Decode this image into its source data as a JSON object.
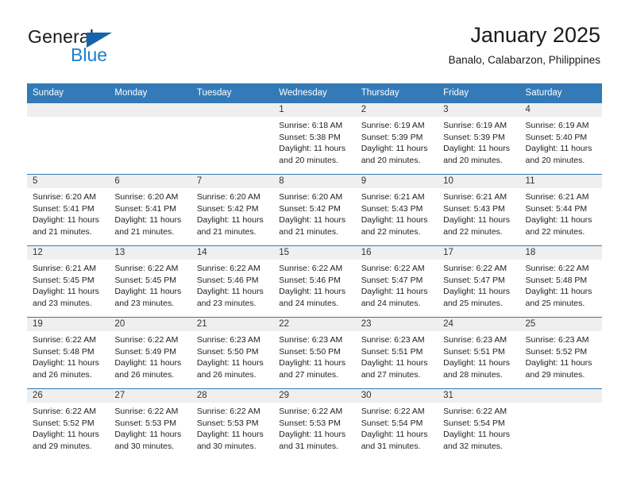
{
  "brand": {
    "name_part1": "General",
    "name_part2": "Blue",
    "triangle_color": "#1464ac",
    "blue_color": "#1a7ed0"
  },
  "header": {
    "title": "January 2025",
    "subtitle": "Banalo, Calabarzon, Philippines"
  },
  "theme": {
    "header_row_bg": "#337ab7",
    "daynum_bg": "#efefef",
    "grid_line": "#337ab7"
  },
  "calendar": {
    "weekday_headers": [
      "Sunday",
      "Monday",
      "Tuesday",
      "Wednesday",
      "Thursday",
      "Friday",
      "Saturday"
    ],
    "weeks": [
      [
        {
          "day": "",
          "empty": true
        },
        {
          "day": "",
          "empty": true
        },
        {
          "day": "",
          "empty": true
        },
        {
          "day": "1",
          "sunrise": "Sunrise: 6:18 AM",
          "sunset": "Sunset: 5:38 PM",
          "daylight": "Daylight: 11 hours and 20 minutes."
        },
        {
          "day": "2",
          "sunrise": "Sunrise: 6:19 AM",
          "sunset": "Sunset: 5:39 PM",
          "daylight": "Daylight: 11 hours and 20 minutes."
        },
        {
          "day": "3",
          "sunrise": "Sunrise: 6:19 AM",
          "sunset": "Sunset: 5:39 PM",
          "daylight": "Daylight: 11 hours and 20 minutes."
        },
        {
          "day": "4",
          "sunrise": "Sunrise: 6:19 AM",
          "sunset": "Sunset: 5:40 PM",
          "daylight": "Daylight: 11 hours and 20 minutes."
        }
      ],
      [
        {
          "day": "5",
          "sunrise": "Sunrise: 6:20 AM",
          "sunset": "Sunset: 5:41 PM",
          "daylight": "Daylight: 11 hours and 21 minutes."
        },
        {
          "day": "6",
          "sunrise": "Sunrise: 6:20 AM",
          "sunset": "Sunset: 5:41 PM",
          "daylight": "Daylight: 11 hours and 21 minutes."
        },
        {
          "day": "7",
          "sunrise": "Sunrise: 6:20 AM",
          "sunset": "Sunset: 5:42 PM",
          "daylight": "Daylight: 11 hours and 21 minutes."
        },
        {
          "day": "8",
          "sunrise": "Sunrise: 6:20 AM",
          "sunset": "Sunset: 5:42 PM",
          "daylight": "Daylight: 11 hours and 21 minutes."
        },
        {
          "day": "9",
          "sunrise": "Sunrise: 6:21 AM",
          "sunset": "Sunset: 5:43 PM",
          "daylight": "Daylight: 11 hours and 22 minutes."
        },
        {
          "day": "10",
          "sunrise": "Sunrise: 6:21 AM",
          "sunset": "Sunset: 5:43 PM",
          "daylight": "Daylight: 11 hours and 22 minutes."
        },
        {
          "day": "11",
          "sunrise": "Sunrise: 6:21 AM",
          "sunset": "Sunset: 5:44 PM",
          "daylight": "Daylight: 11 hours and 22 minutes."
        }
      ],
      [
        {
          "day": "12",
          "sunrise": "Sunrise: 6:21 AM",
          "sunset": "Sunset: 5:45 PM",
          "daylight": "Daylight: 11 hours and 23 minutes."
        },
        {
          "day": "13",
          "sunrise": "Sunrise: 6:22 AM",
          "sunset": "Sunset: 5:45 PM",
          "daylight": "Daylight: 11 hours and 23 minutes."
        },
        {
          "day": "14",
          "sunrise": "Sunrise: 6:22 AM",
          "sunset": "Sunset: 5:46 PM",
          "daylight": "Daylight: 11 hours and 23 minutes."
        },
        {
          "day": "15",
          "sunrise": "Sunrise: 6:22 AM",
          "sunset": "Sunset: 5:46 PM",
          "daylight": "Daylight: 11 hours and 24 minutes."
        },
        {
          "day": "16",
          "sunrise": "Sunrise: 6:22 AM",
          "sunset": "Sunset: 5:47 PM",
          "daylight": "Daylight: 11 hours and 24 minutes."
        },
        {
          "day": "17",
          "sunrise": "Sunrise: 6:22 AM",
          "sunset": "Sunset: 5:47 PM",
          "daylight": "Daylight: 11 hours and 25 minutes."
        },
        {
          "day": "18",
          "sunrise": "Sunrise: 6:22 AM",
          "sunset": "Sunset: 5:48 PM",
          "daylight": "Daylight: 11 hours and 25 minutes."
        }
      ],
      [
        {
          "day": "19",
          "sunrise": "Sunrise: 6:22 AM",
          "sunset": "Sunset: 5:48 PM",
          "daylight": "Daylight: 11 hours and 26 minutes."
        },
        {
          "day": "20",
          "sunrise": "Sunrise: 6:22 AM",
          "sunset": "Sunset: 5:49 PM",
          "daylight": "Daylight: 11 hours and 26 minutes."
        },
        {
          "day": "21",
          "sunrise": "Sunrise: 6:23 AM",
          "sunset": "Sunset: 5:50 PM",
          "daylight": "Daylight: 11 hours and 26 minutes."
        },
        {
          "day": "22",
          "sunrise": "Sunrise: 6:23 AM",
          "sunset": "Sunset: 5:50 PM",
          "daylight": "Daylight: 11 hours and 27 minutes."
        },
        {
          "day": "23",
          "sunrise": "Sunrise: 6:23 AM",
          "sunset": "Sunset: 5:51 PM",
          "daylight": "Daylight: 11 hours and 27 minutes."
        },
        {
          "day": "24",
          "sunrise": "Sunrise: 6:23 AM",
          "sunset": "Sunset: 5:51 PM",
          "daylight": "Daylight: 11 hours and 28 minutes."
        },
        {
          "day": "25",
          "sunrise": "Sunrise: 6:23 AM",
          "sunset": "Sunset: 5:52 PM",
          "daylight": "Daylight: 11 hours and 29 minutes."
        }
      ],
      [
        {
          "day": "26",
          "sunrise": "Sunrise: 6:22 AM",
          "sunset": "Sunset: 5:52 PM",
          "daylight": "Daylight: 11 hours and 29 minutes."
        },
        {
          "day": "27",
          "sunrise": "Sunrise: 6:22 AM",
          "sunset": "Sunset: 5:53 PM",
          "daylight": "Daylight: 11 hours and 30 minutes."
        },
        {
          "day": "28",
          "sunrise": "Sunrise: 6:22 AM",
          "sunset": "Sunset: 5:53 PM",
          "daylight": "Daylight: 11 hours and 30 minutes."
        },
        {
          "day": "29",
          "sunrise": "Sunrise: 6:22 AM",
          "sunset": "Sunset: 5:53 PM",
          "daylight": "Daylight: 11 hours and 31 minutes."
        },
        {
          "day": "30",
          "sunrise": "Sunrise: 6:22 AM",
          "sunset": "Sunset: 5:54 PM",
          "daylight": "Daylight: 11 hours and 31 minutes."
        },
        {
          "day": "31",
          "sunrise": "Sunrise: 6:22 AM",
          "sunset": "Sunset: 5:54 PM",
          "daylight": "Daylight: 11 hours and 32 minutes."
        },
        {
          "day": "",
          "empty": true
        }
      ]
    ]
  }
}
